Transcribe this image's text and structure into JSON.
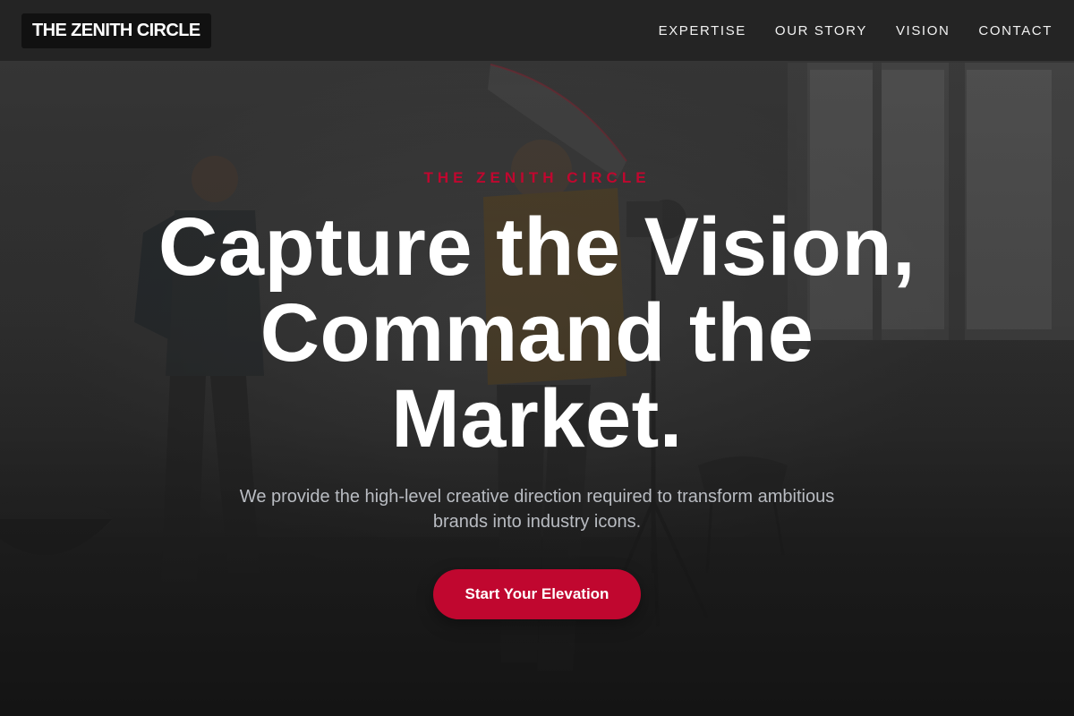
{
  "header": {
    "logo_text": "THE ZENITH CIRCLE",
    "nav": [
      {
        "label": "EXPERTISE"
      },
      {
        "label": "OUR STORY"
      },
      {
        "label": "VISION"
      },
      {
        "label": "CONTACT"
      }
    ]
  },
  "hero": {
    "eyebrow": "THE ZENITH CIRCLE",
    "headline_lines": [
      "Capture the Vision,",
      "Command the",
      "Market."
    ],
    "subtext_lines": [
      "We provide the high-level creative direction required to transform ambitious",
      "brands into industry icons."
    ],
    "cta_label": "Start Your Elevation",
    "background": "photo-studio-scene"
  },
  "colors": {
    "accent": "#c0072f",
    "header_bg": "#232323",
    "headline": "#ffffff",
    "subtext": "#b9bcc2",
    "nav_text": "#f2f2f2"
  }
}
